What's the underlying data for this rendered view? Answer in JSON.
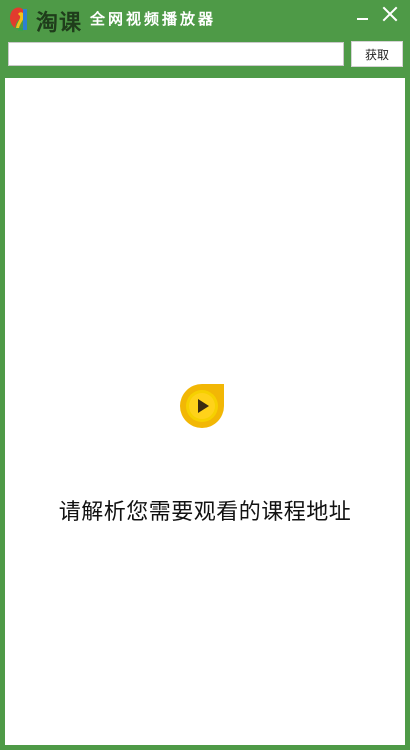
{
  "app": {
    "logo_text": "淘课",
    "title": "全网视频播放器"
  },
  "window_controls": {
    "minimize_icon": "minimize-icon",
    "close_icon": "close-icon"
  },
  "toolbar": {
    "url_value": "",
    "url_placeholder": "",
    "fetch_label": "获取"
  },
  "main": {
    "icon": "play-icon",
    "prompt": "请解析您需要观看的课程地址"
  },
  "colors": {
    "frame": "#4e9a47",
    "content_bg": "#ffffff",
    "icon_outer": "#f2b705",
    "icon_inner": "#f6d000"
  }
}
